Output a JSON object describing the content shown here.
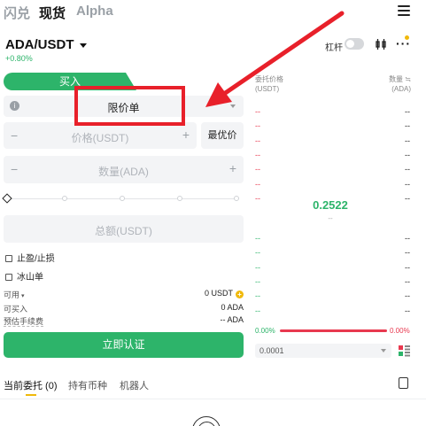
{
  "top_tabs": [
    "闪兑",
    "现货",
    "Alpha"
  ],
  "active_top_tab": "现货",
  "pair": {
    "name": "ADA/USDT",
    "change": "+0.80%"
  },
  "header_tools": {
    "leverage_label": "杠杆"
  },
  "trade_tabs": {
    "buy": "买入",
    "sell": "卖出"
  },
  "order_type": "限价单",
  "price_field": {
    "placeholder": "价格(USDT)",
    "minus": "−",
    "plus": "+",
    "best_price_label": "最优价"
  },
  "qty_field": {
    "placeholder": "数量(ADA)",
    "minus": "−",
    "plus": "+"
  },
  "slider": {
    "value_percent": 0
  },
  "total_field": {
    "placeholder": "总额(USDT)"
  },
  "options": {
    "tp_sl": "止盈/止损",
    "iceberg": "冰山单"
  },
  "balances": {
    "available_label": "可用",
    "available_value": "0 USDT",
    "can_buy_label": "可买入",
    "can_buy_value": "0 ADA",
    "fee_label": "预估手续费",
    "fee_value": "-- ADA"
  },
  "submit_label": "立即认证",
  "bottom_tabs": {
    "open_orders": "当前委托 (0)",
    "holdings": "持有币种",
    "bots": "机器人"
  },
  "order_book": {
    "price_header": "委托价格",
    "price_unit": "(USDT)",
    "qty_header": "数量 ≒",
    "qty_unit": "(ADA)",
    "asks": [
      {
        "price": "--",
        "qty": "--"
      },
      {
        "price": "--",
        "qty": "--"
      },
      {
        "price": "--",
        "qty": "--"
      },
      {
        "price": "--",
        "qty": "--"
      },
      {
        "price": "--",
        "qty": "--"
      },
      {
        "price": "--",
        "qty": "--"
      },
      {
        "price": "--",
        "qty": "--"
      }
    ],
    "last_price": "0.2522",
    "last_sub": "--",
    "bids": [
      {
        "price": "--",
        "qty": "--"
      },
      {
        "price": "--",
        "qty": "--"
      },
      {
        "price": "--",
        "qty": "--"
      },
      {
        "price": "--",
        "qty": "--"
      },
      {
        "price": "--",
        "qty": "--"
      },
      {
        "price": "--",
        "qty": "--"
      }
    ],
    "buy_ratio": "0.00%",
    "sell_ratio": "0.00%",
    "precision": "0.0001"
  },
  "colors": {
    "green": "#2db46a",
    "red": "#e8384f",
    "annotation": "#e8202a",
    "coin": "#f0b90b"
  }
}
